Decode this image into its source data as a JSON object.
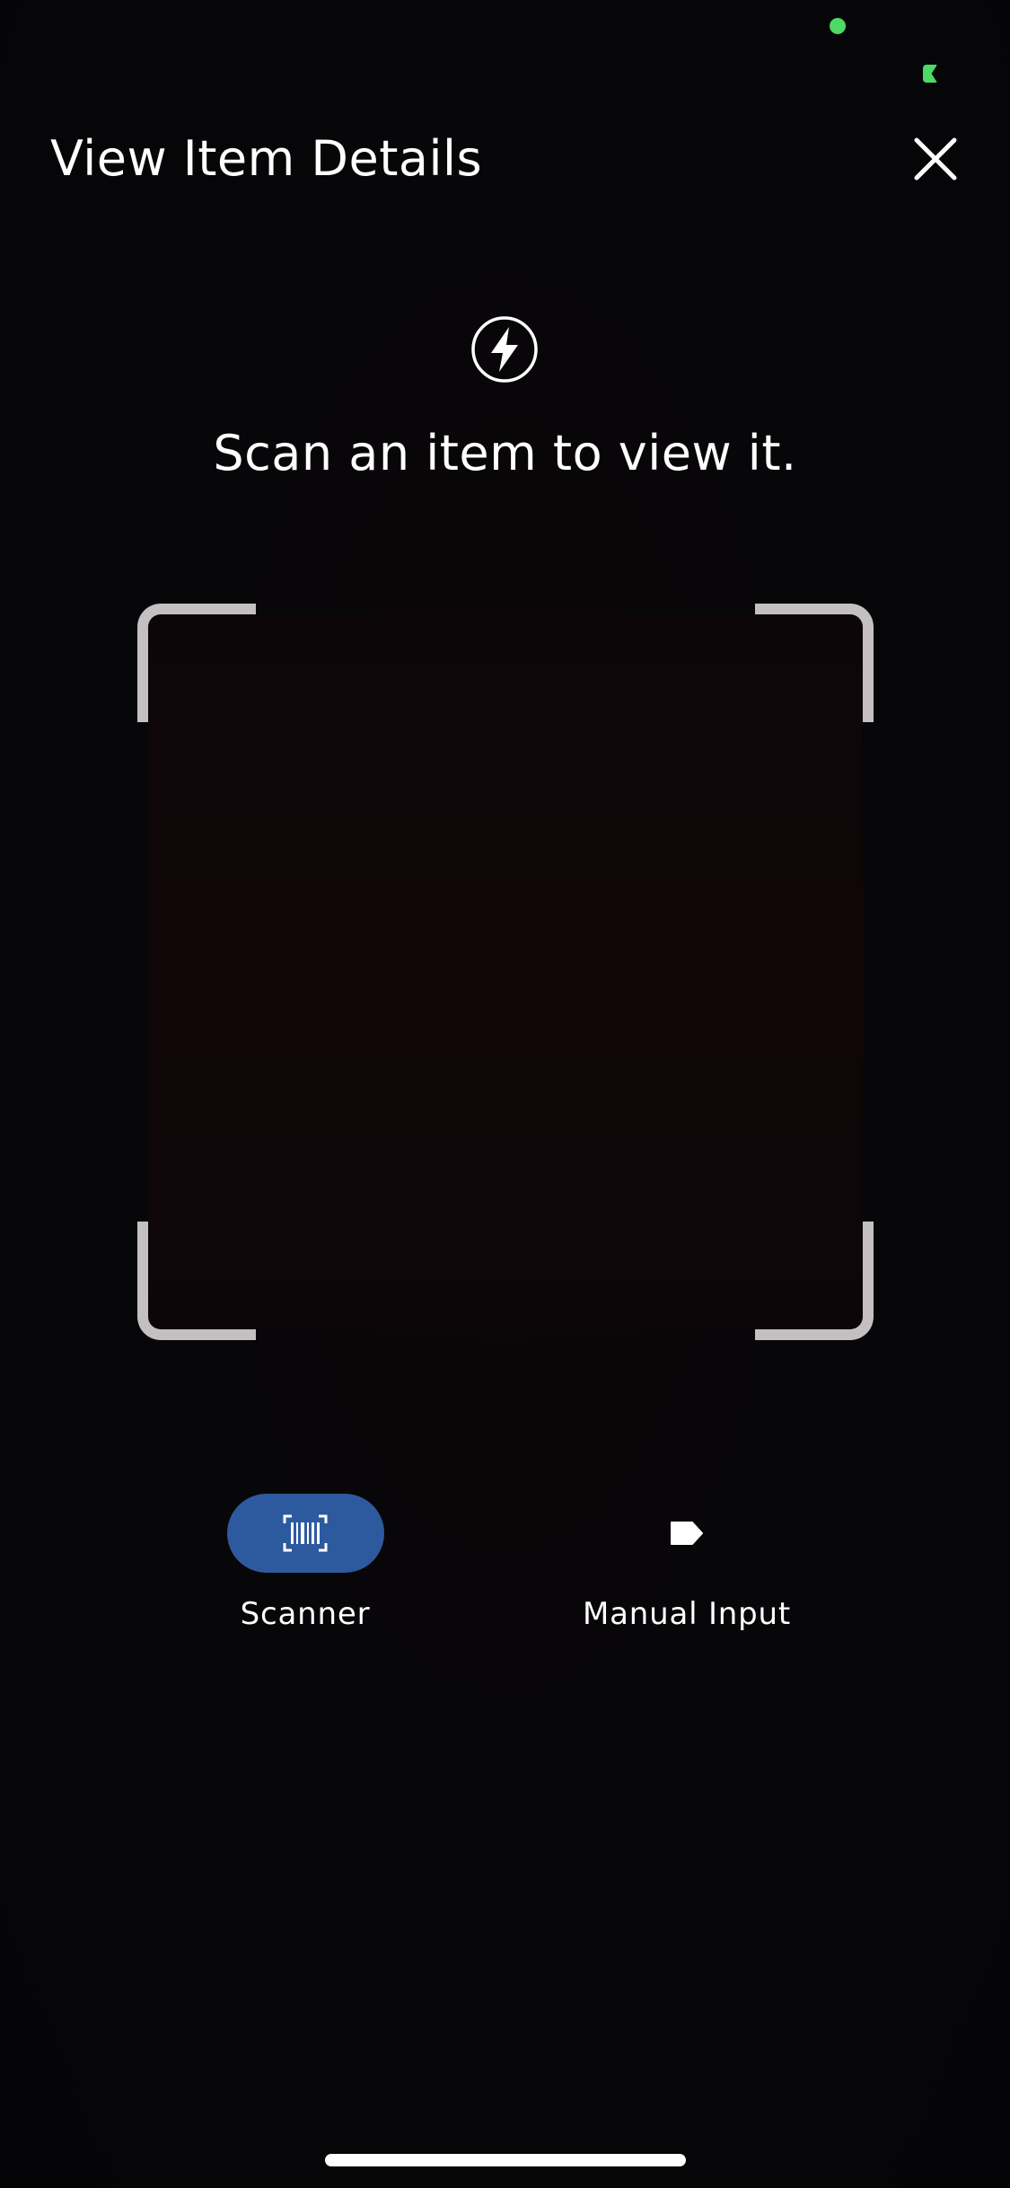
{
  "header": {
    "title": "View Item Details"
  },
  "scanner": {
    "instruction": "Scan an item to view it."
  },
  "mode_tabs": [
    {
      "label": "Scanner",
      "icon": "barcode-icon",
      "active": true
    },
    {
      "label": "Manual Input",
      "icon": "tag-icon",
      "active": false
    }
  ],
  "colors": {
    "background": "#060608",
    "accent": "#2d5a9e",
    "frame": "#c4c0c2",
    "status_green": "#4cd964",
    "text": "#ffffff"
  },
  "icons": {
    "close": "close-icon",
    "flash": "flash-icon"
  }
}
